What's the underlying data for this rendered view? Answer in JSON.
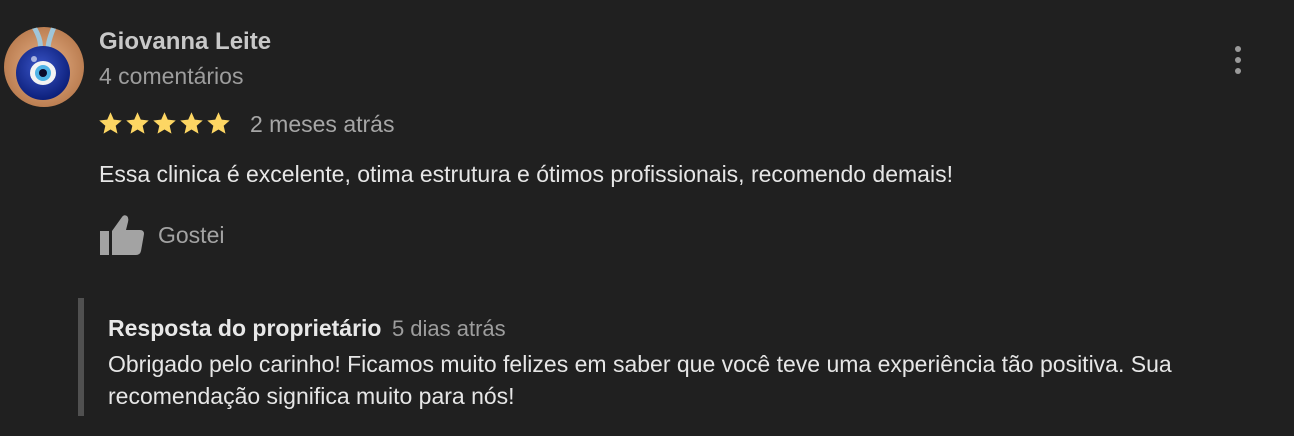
{
  "review": {
    "reviewer_name": "Giovanna Leite",
    "review_count": "4 comentários",
    "rating": 5,
    "max_rating": 5,
    "time": "2 meses atrás",
    "text": "Essa clinica é excelente, otima estrutura e ótimos profissionais, recomendo demais!",
    "like_label": "Gostei",
    "avatar_icon": "evil-eye-amulet-icon",
    "more_icon": "more-vert-icon",
    "star_color": "#fdd663"
  },
  "owner_reply": {
    "title": "Resposta do proprietário",
    "time": "5 dias atrás",
    "text": "Obrigado pelo carinho! Ficamos muito felizes em saber que você teve uma experiência tão positiva. Sua recomendação significa muito para nós!"
  }
}
